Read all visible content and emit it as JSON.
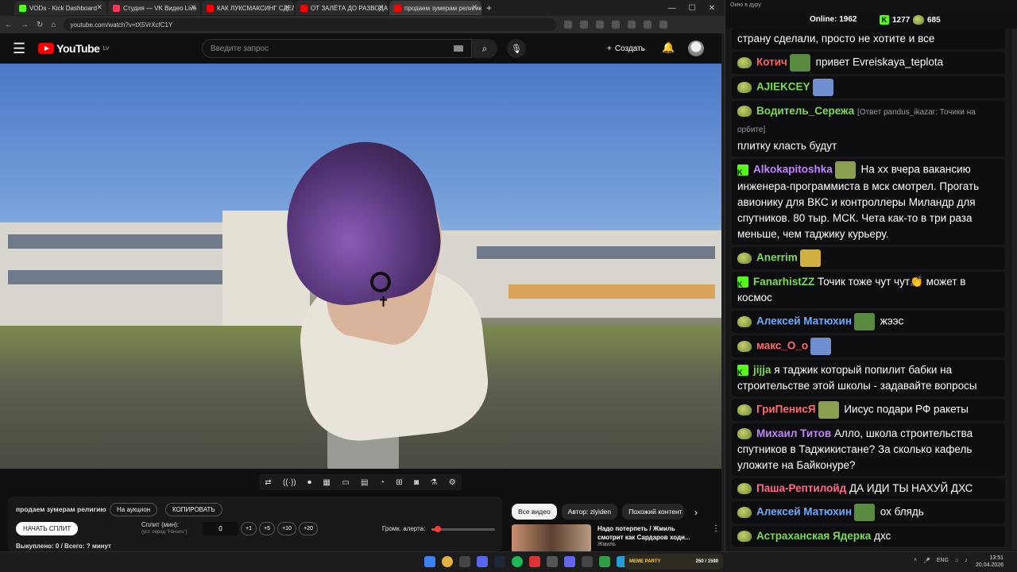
{
  "browser": {
    "tabs": [
      {
        "label": "VODs - Kick Dashboard",
        "color": "#53fc18"
      },
      {
        "label": "Студия — VK Видео Live",
        "color": "#ff3355"
      },
      {
        "label": "КАК ЛУКСМАКСИНГ СДЕЛАЛ",
        "color": "#ff0000"
      },
      {
        "label": "ОТ ЗАЛЁТА ДО РАЗВОДА: по",
        "color": "#ff0000"
      },
      {
        "label": "продаем зумерам религию -",
        "color": "#ff0000"
      }
    ],
    "new_tab": "+",
    "url": "youtube.com/watch?v=tX5VrXcfC1Y"
  },
  "youtube": {
    "region": "LV",
    "logo_text": "YouTube",
    "search_placeholder": "Введите запрос",
    "create_label": "Создать"
  },
  "panel": {
    "title": "продаем зумерам религию",
    "auction_label": "На аукцион",
    "copy_label": "КОПИРОВАТЬ",
    "start_split_label": "НАЧАТЬ СПЛИТ",
    "split_label": "Сплит (мин):",
    "split_sub": "(уст. перед \"Начать\")",
    "split_value": "0",
    "increments": [
      "+1",
      "+5",
      "+10",
      "+20"
    ],
    "alert_volume_label": "Громк. алерта:",
    "alert_volume": 0.1,
    "bought_label": "Выкуплено: 0 / Всего: ? минут"
  },
  "recommendations": {
    "chips": [
      "Все видео",
      "Автор: zlyiden",
      "Похожий контент"
    ],
    "video_title": "Надо потерпеть / Жмиль смотрит как Сардаров ходи...",
    "video_channel": "Жмиль"
  },
  "chat": {
    "window_title": "Окно в дуру",
    "online_label": "Online:",
    "online_count": "1962",
    "kick_count": "1277",
    "vk_count": "685",
    "messages": [
      {
        "platform": "",
        "user": "",
        "user_color": "#ffffff",
        "reply": "",
        "text": "страну сделали, просто не хотите и все"
      },
      {
        "platform": "vk",
        "user": "Котич",
        "user_color": "#ff5f5f",
        "reply": "",
        "text": "привет Evreiskaya_teplota"
      },
      {
        "platform": "vk",
        "user": "AJIEKCEY",
        "user_color": "#7ed957",
        "reply": "",
        "text": ""
      },
      {
        "platform": "vk",
        "user": "Водитель_Сережа",
        "user_color": "#7ed957",
        "reply": "[Ответ pandus_ikazar: Точики на орбите]",
        "text": "плитку класть будут"
      },
      {
        "platform": "kick",
        "user": "Alkokapitoshka",
        "user_color": "#c084fc",
        "reply": "",
        "text": "На хх вчера вакансию инженера-программиста в мск смотрел. Прогать авионику для ВКС и контроллеры Миландр для спутников. 80 тыр. МСК. Чета как-то в три раза меньше, чем таджику курьеру."
      },
      {
        "platform": "vk",
        "user": "Anerrim",
        "user_color": "#7ed957",
        "reply": "",
        "text": ""
      },
      {
        "platform": "kick",
        "user": "FanarhistZZ",
        "user_color": "#7ed957",
        "reply": "",
        "text": "Точик тоже чут чут👏 может в космос"
      },
      {
        "platform": "vk",
        "user": "Алексей Матюхин",
        "user_color": "#6ea8ff",
        "reply": "",
        "text": "жээс"
      },
      {
        "platform": "vk",
        "user": "макс_О_о",
        "user_color": "#ff6b6b",
        "reply": "",
        "text": ""
      },
      {
        "platform": "kick",
        "user": "jijja",
        "user_color": "#7ed957",
        "reply": "",
        "text": "я таджик который попилит бабки на строительстве этой школы - задавайте вопросы"
      },
      {
        "platform": "vk",
        "user": "ГриПенисЯ",
        "user_color": "#ff6b6b",
        "reply": "",
        "text": "Иисус подари РФ ракеты"
      },
      {
        "platform": "vk",
        "user": "Михаил Титов",
        "user_color": "#c084fc",
        "reply": "",
        "text": "Алло, школа строительства спутников в Таджикистане? За сколько кафель уложите на Байконуре?"
      },
      {
        "platform": "vk",
        "user": "Паша-Рептилойд",
        "user_color": "#ff6b8a",
        "reply": "",
        "text": "ДА ИДИ ТЫ НАХУЙ ДХС"
      },
      {
        "platform": "vk",
        "user": "Алексей Матюхин",
        "user_color": "#6ea8ff",
        "reply": "",
        "text": "ох блядь"
      },
      {
        "platform": "vk",
        "user": "Астраханская Ядерка",
        "user_color": "#7ed957",
        "reply": "",
        "text": "дхс"
      }
    ]
  },
  "taskbar": {
    "meme_party": "MEME PARTY",
    "meme_count": "250 / 1590",
    "lang": "ENG",
    "time": "13:51",
    "date": "20.04.2026"
  },
  "colors": {
    "accent_red": "#ff0000",
    "kick_green": "#53fc18",
    "chat_bg": "#18181b"
  }
}
